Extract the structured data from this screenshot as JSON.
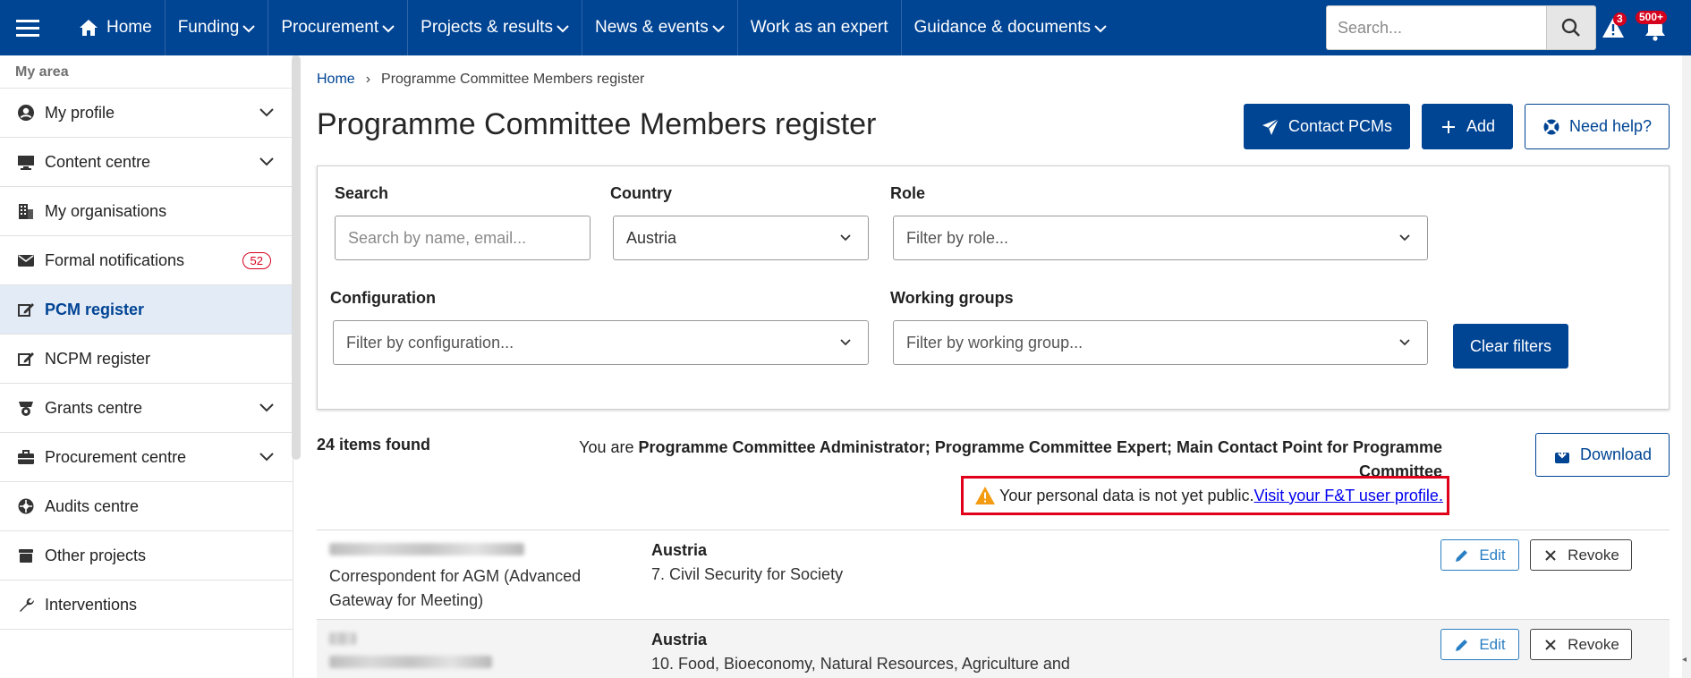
{
  "topnav": {
    "home": "Home",
    "items": [
      "Funding",
      "Procurement",
      "Projects & results",
      "News & events",
      "Work as an expert",
      "Guidance & documents"
    ],
    "search_placeholder": "Search...",
    "alerts_count": "3",
    "notifications_count": "500+"
  },
  "sidebar": {
    "title": "My area",
    "items": [
      {
        "label": "My profile",
        "icon": "user-circle-icon",
        "expandable": true
      },
      {
        "label": "Content centre",
        "icon": "monitor-icon",
        "expandable": true
      },
      {
        "label": "My organisations",
        "icon": "building-icon",
        "expandable": false
      },
      {
        "label": "Formal notifications",
        "icon": "envelope-icon",
        "expandable": false,
        "badge": "52"
      },
      {
        "label": "PCM register",
        "icon": "edit-square-icon",
        "expandable": false,
        "active": true
      },
      {
        "label": "NCPM register",
        "icon": "edit-square-icon",
        "expandable": false
      },
      {
        "label": "Grants centre",
        "icon": "grants-icon",
        "expandable": true
      },
      {
        "label": "Procurement centre",
        "icon": "briefcase-icon",
        "expandable": true
      },
      {
        "label": "Audits centre",
        "icon": "audit-icon",
        "expandable": false
      },
      {
        "label": "Other projects",
        "icon": "archive-icon",
        "expandable": false
      },
      {
        "label": "Interventions",
        "icon": "wrench-icon",
        "expandable": false
      }
    ]
  },
  "breadcrumb": {
    "home": "Home",
    "current": "Programme Committee Members register"
  },
  "page": {
    "title": "Programme Committee Members register",
    "contact_label": "Contact PCMs",
    "add_label": "Add",
    "help_label": "Need help?"
  },
  "filters": {
    "search_label": "Search",
    "search_placeholder": "Search by name, email...",
    "country_label": "Country",
    "country_value": "Austria",
    "role_label": "Role",
    "role_placeholder": "Filter by role...",
    "configuration_label": "Configuration",
    "configuration_placeholder": "Filter by configuration...",
    "working_groups_label": "Working groups",
    "working_groups_placeholder": "Filter by working group...",
    "clear_label": "Clear filters"
  },
  "results": {
    "count": "24 items found",
    "role_prefix": "You are ",
    "role_bold_line1": "Programme Committee Administrator; Programme Committee Expert; Main Contact Point for Programme",
    "role_bold_line2": "Committee",
    "download_label": "Download",
    "warning_text": "Your personal data is not yet public.",
    "warning_link": "Visit your F&T user profile."
  },
  "rows": [
    {
      "subtitle": "Correspondent for AGM (Advanced Gateway for Meeting)",
      "country": "Austria",
      "group": "7. Civil Security for Society",
      "edit_label": "Edit",
      "revoke_label": "Revoke"
    },
    {
      "subtitle": "",
      "country": "Austria",
      "group": "10. Food, Bioeconomy, Natural Resources, Agriculture and",
      "edit_label": "Edit",
      "revoke_label": "Revoke"
    }
  ],
  "colors": {
    "brand": "#004494",
    "alert": "#d6001c",
    "warning_border": "#e0001a"
  }
}
